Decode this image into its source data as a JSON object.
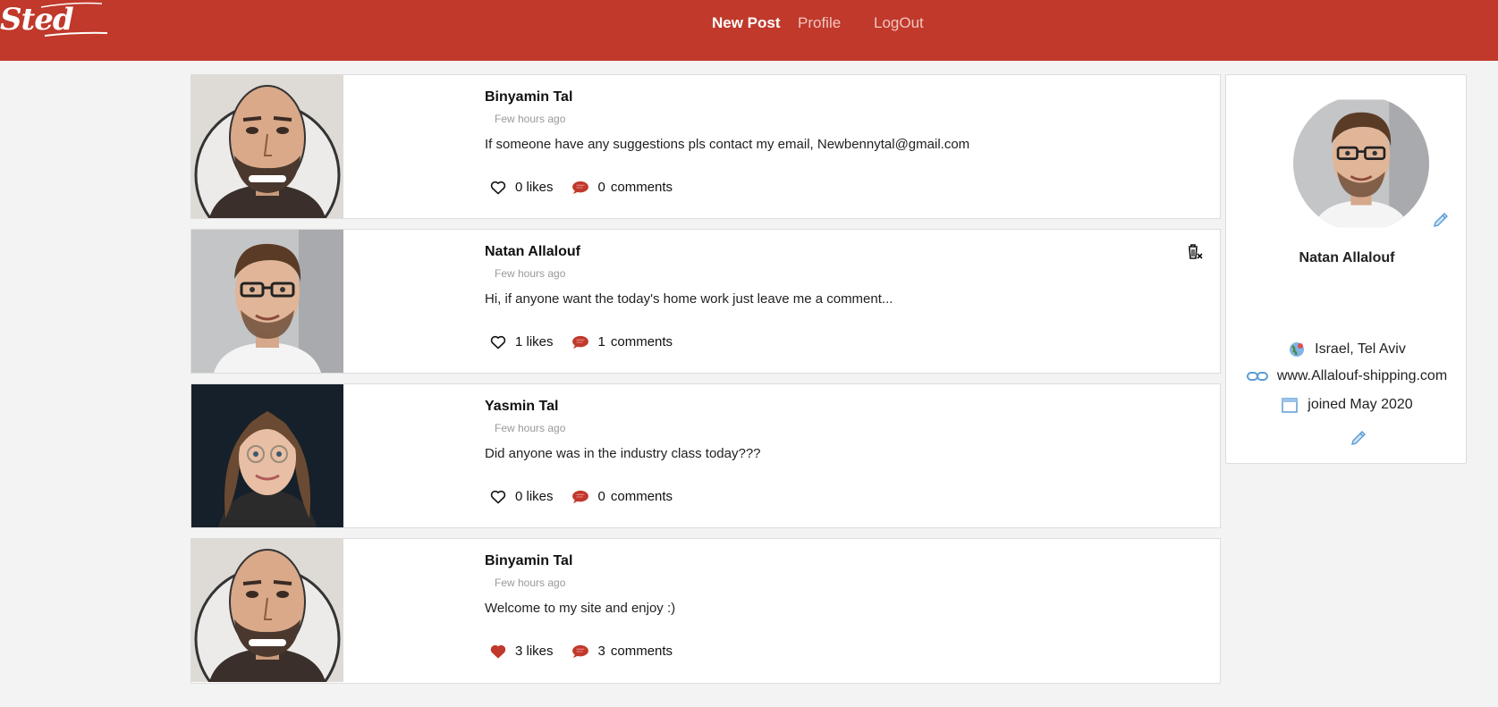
{
  "brand": {
    "logo_text": "Sted"
  },
  "nav": {
    "new_post": "New Post",
    "profile": "Profile",
    "logout": "LogOut"
  },
  "posts": [
    {
      "author": "Binyamin Tal",
      "time": "Few hours ago",
      "text": "If someone have any suggestions pls contact my email, Newbennytal@gmail.com",
      "likes_label": "0 likes",
      "comments_count": "0",
      "comments_word": "comments",
      "liked": false,
      "deletable": false
    },
    {
      "author": "Natan Allalouf",
      "time": "Few hours ago",
      "text": "Hi, if anyone want the today's home work just leave me a comment...",
      "likes_label": "1 likes",
      "comments_count": "1",
      "comments_word": "comments",
      "liked": false,
      "deletable": true
    },
    {
      "author": "Yasmin Tal",
      "time": "Few hours ago",
      "text": "Did anyone was in the industry class today???",
      "likes_label": "0 likes",
      "comments_count": "0",
      "comments_word": "comments",
      "liked": false,
      "deletable": false
    },
    {
      "author": "Binyamin Tal",
      "time": "Few hours ago",
      "text": "Welcome to my site and enjoy :)",
      "likes_label": "3 likes",
      "comments_count": "3",
      "comments_word": "comments",
      "liked": true,
      "deletable": false
    }
  ],
  "profile": {
    "name": "Natan Allalouf",
    "location": "Israel, Tel Aviv",
    "website": "www.Allalouf-shipping.com",
    "joined": "joined May 2020"
  },
  "colors": {
    "brand": "#c0392b",
    "like_active": "#c0392b",
    "comment": "#c0392b",
    "edit": "#5b9bd5"
  },
  "icons": [
    "heart-icon",
    "comment-icon",
    "delete-icon",
    "pencil-icon",
    "globe-icon",
    "link-icon",
    "calendar-icon"
  ]
}
